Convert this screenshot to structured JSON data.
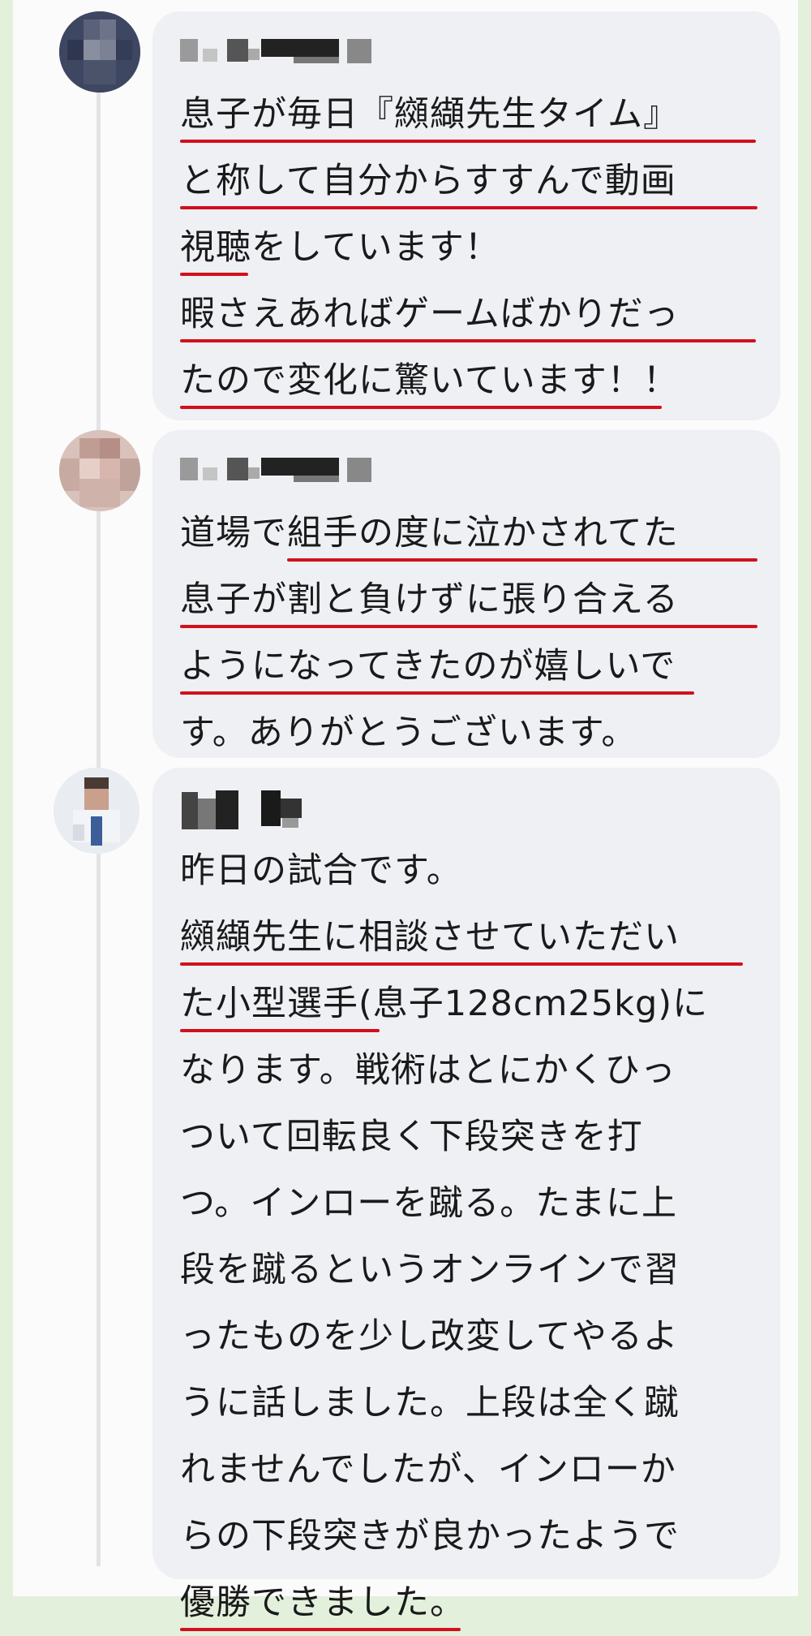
{
  "comments": [
    {
      "lines": [
        "息子が毎日『纐纈先生タイム』",
        "と称して自分からすすんで動画",
        "視聴をしています！",
        "暇さえあればゲームばかりだっ",
        "たので変化に驚いています！！"
      ]
    },
    {
      "lines": [
        "道場で組手の度に泣かされてた",
        "息子が割と負けずに張り合える",
        "ようになってきたのが嬉しいで",
        "す。ありがとうございます。"
      ]
    },
    {
      "lines": [
        "昨日の試合です。",
        "纐纈先生に相談させていただい",
        "た小型選手(息子128cm25kg)に",
        "なります。戦術はとにかくひっ",
        "ついて回転良く下段突きを打",
        "つ。インローを蹴る。たまに上",
        "段を蹴るというオンラインで習",
        "ったものを少し改変してやるよ",
        "うに話しました。上段は全く蹴",
        "れませんでしたが、インローか",
        "らの下段突きが良かったようで",
        "優勝できました。"
      ]
    }
  ],
  "colors": {
    "underline": "#d2101c",
    "bubble": "#eef0f4",
    "page_border": "#e3f0dc"
  }
}
